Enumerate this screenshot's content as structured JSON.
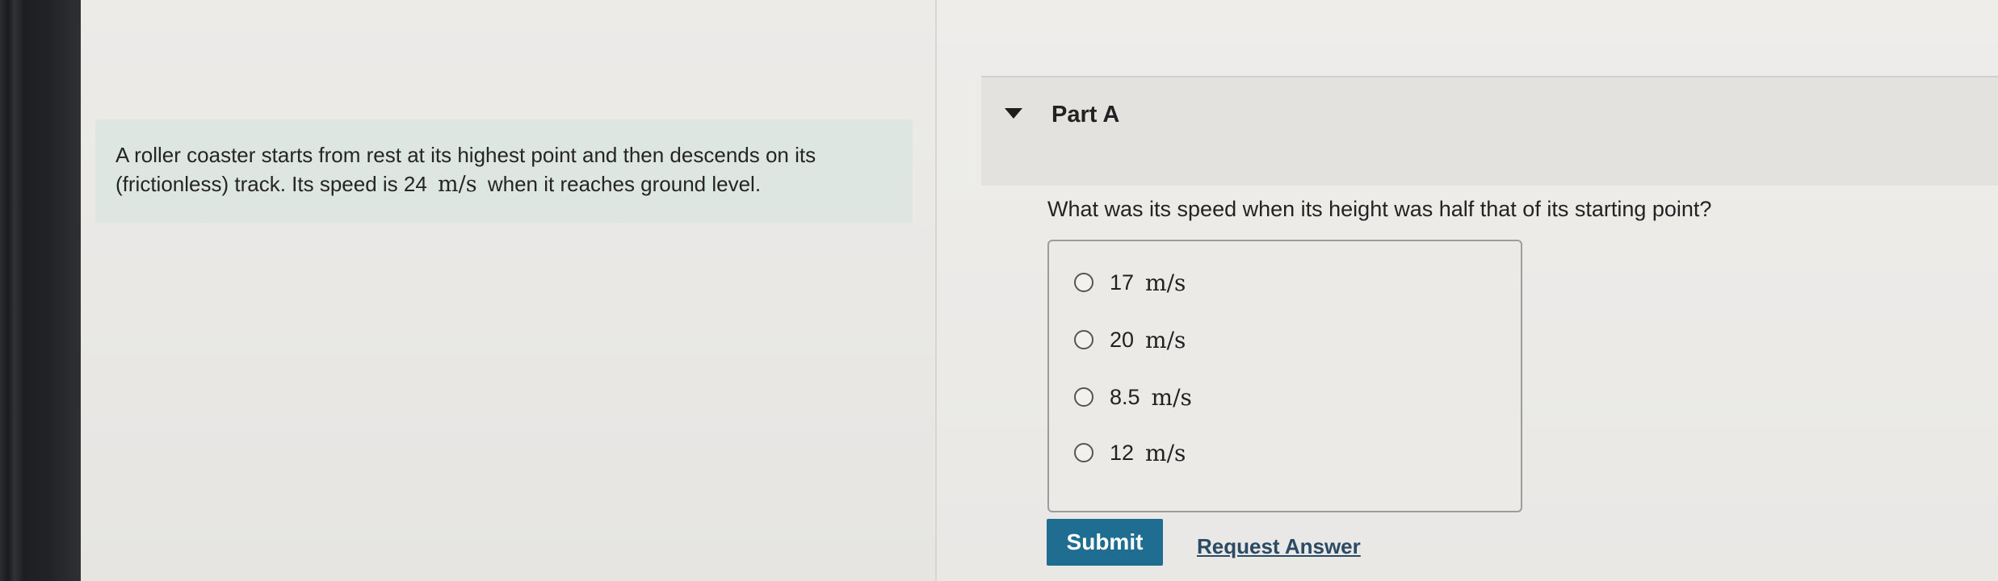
{
  "problem": {
    "text_before_unit": "A roller coaster starts from rest at its highest point and then descends on its (frictionless) track. Its speed is 24",
    "unit": "m/s",
    "text_after_unit": "when it reaches ground level."
  },
  "part": {
    "title": "Part A",
    "question": "What was its speed when its height was half that of its starting point?",
    "choices": [
      {
        "value": "17",
        "unit": "m/s"
      },
      {
        "value": "20",
        "unit": "m/s"
      },
      {
        "value": "8.5",
        "unit": "m/s"
      },
      {
        "value": "12",
        "unit": "m/s"
      }
    ]
  },
  "actions": {
    "submit_label": "Submit",
    "request_answer_label": "Request Answer"
  },
  "colors": {
    "submit_bg": "#1f6e92",
    "problem_bg": "#dde6e1",
    "link_color": "#2a4a66"
  },
  "icons": {
    "collapse": "caret-down-icon",
    "choice_marker": "radio-icon"
  }
}
